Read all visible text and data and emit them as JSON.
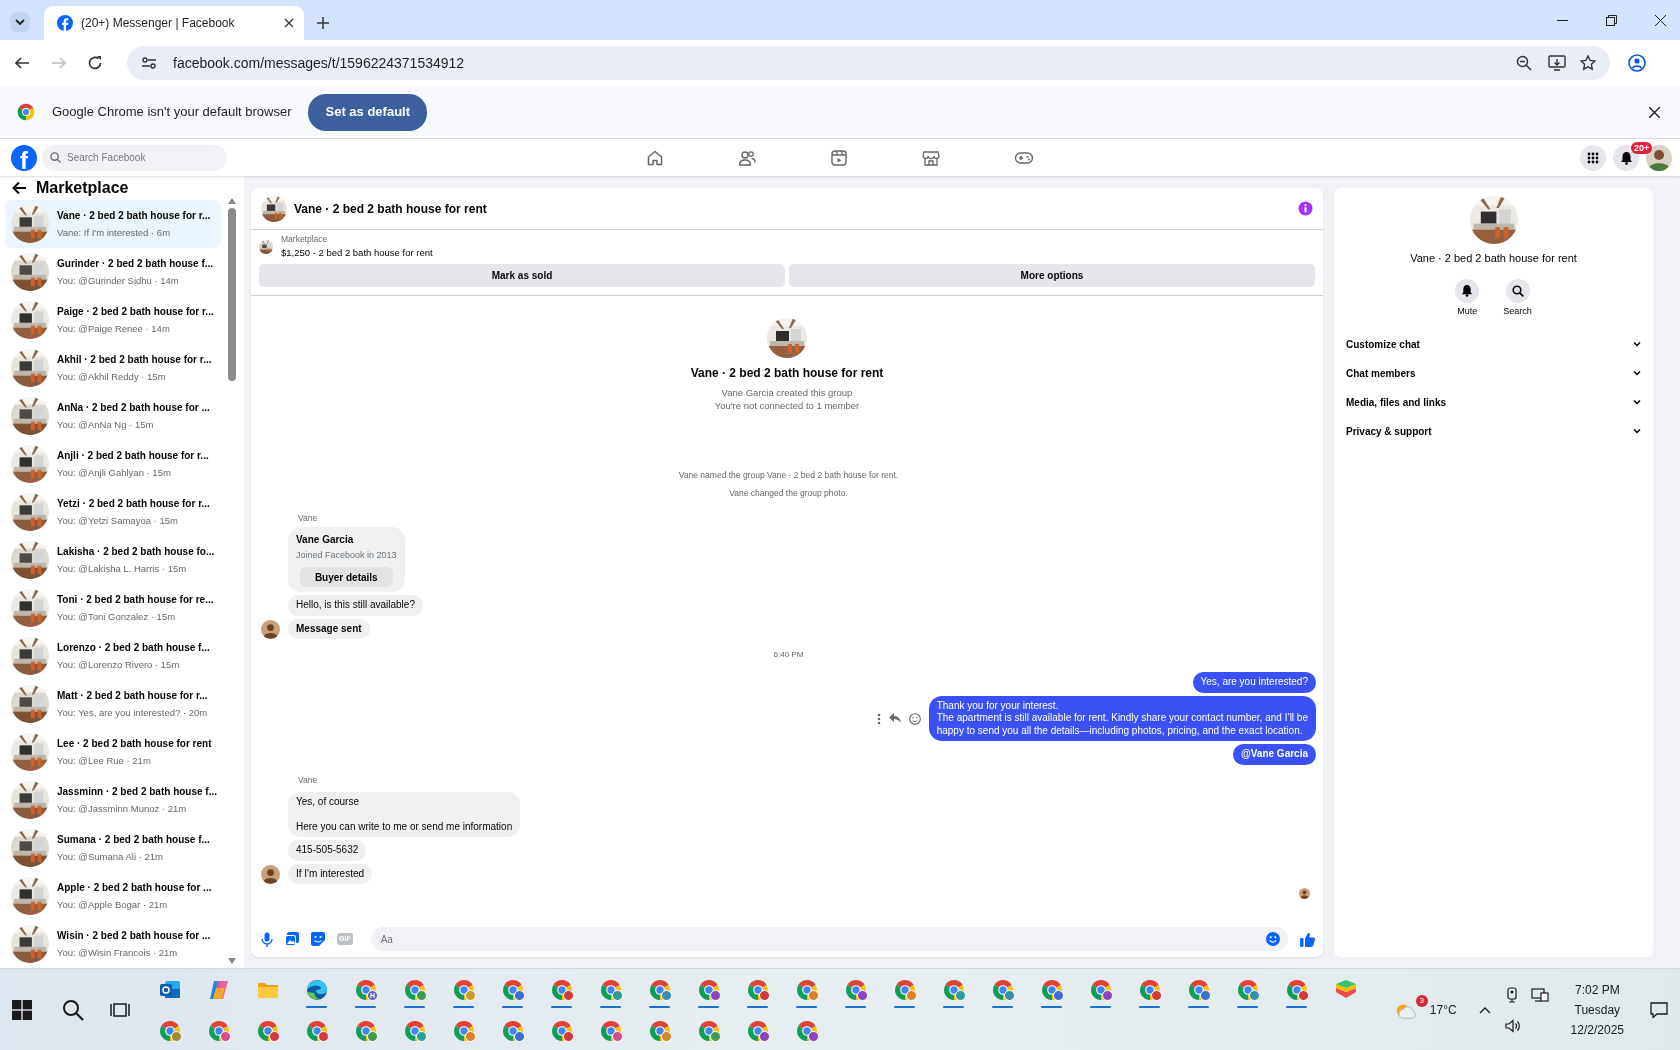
{
  "browser": {
    "tab_title": "(20+) Messenger | Facebook",
    "url": "facebook.com/messages/t/1596224371534912",
    "forward_disabled": true,
    "infobar": {
      "message": "Google Chrome isn't your default browser",
      "button": "Set as default"
    }
  },
  "facebook_nav": {
    "logo": "f",
    "search_placeholder": "Search Facebook",
    "notifications_badge": "20+"
  },
  "sidebar": {
    "title": "Marketplace",
    "conversations": [
      {
        "title": "Vane · 2 bed 2 bath house for r...",
        "preview": "Vane: If I'm interested · 6m",
        "selected": true
      },
      {
        "title": "Gurinder · 2 bed 2 bath house f...",
        "preview": "You: @Gurinder Sidhu · 14m",
        "selected": false
      },
      {
        "title": "Paige · 2 bed 2 bath house for r...",
        "preview": "You: @Paige Renee · 14m",
        "selected": false
      },
      {
        "title": "Akhil · 2 bed 2 bath house for r...",
        "preview": "You: @Akhil Reddy · 15m",
        "selected": false
      },
      {
        "title": "AnNa · 2 bed 2 bath house for ...",
        "preview": "You: @AnNa Ng · 15m",
        "selected": false
      },
      {
        "title": "Anjli · 2 bed 2 bath house for r...",
        "preview": "You: @Anjli Gahlyan · 15m",
        "selected": false
      },
      {
        "title": "Yetzi · 2 bed 2 bath house for r...",
        "preview": "You: @Yetzi Samayoa · 15m",
        "selected": false
      },
      {
        "title": "Lakisha · 2 bed 2 bath house fo...",
        "preview": "You: @Lakisha L. Harris · 15m",
        "selected": false
      },
      {
        "title": "Toni · 2 bed 2 bath house for re...",
        "preview": "You: @Toni Gonzalez · 15m",
        "selected": false
      },
      {
        "title": "Lorenzo · 2 bed 2 bath house f...",
        "preview": "You: @Lorenzo Rivero · 15m",
        "selected": false
      },
      {
        "title": "Matt · 2 bed 2 bath house for r...",
        "preview": "You: Yes, are you interested? · 20m",
        "selected": false
      },
      {
        "title": "Lee · 2 bed 2 bath house for rent",
        "preview": "You: @Lee Rue · 21m",
        "selected": false
      },
      {
        "title": "Jassminn · 2 bed 2 bath house f...",
        "preview": "You: @Jassminn Munoz · 21m",
        "selected": false
      },
      {
        "title": "Sumana · 2 bed 2 bath house f...",
        "preview": "You: @Sumana Ali · 21m",
        "selected": false
      },
      {
        "title": "Apple · 2 bed 2 bath house for ...",
        "preview": "You: @Apple Bogar · 21m",
        "selected": false
      },
      {
        "title": "Wisin · 2 bed 2 bath house for ...",
        "preview": "You: @Wisin Francois · 21m",
        "selected": false
      }
    ]
  },
  "chat": {
    "title": "Vane · 2 bed 2 bath house for rent",
    "listing": {
      "label": "Marketplace",
      "text": "$1,250 - 2 bed 2 bath house for rent"
    },
    "actions": [
      "Mark as sold",
      "More options"
    ],
    "intro": {
      "title": "Vane · 2 bed 2 bath house for rent",
      "lines": [
        "Vane Garcia created this group",
        "You're not connected to 1 member"
      ]
    },
    "messages": [
      {
        "kind": "system",
        "text": "Vane named the group Vane · 2 bed 2 bath house for rent."
      },
      {
        "kind": "system",
        "text": "Vane changed the group photo."
      },
      {
        "kind": "sender",
        "text": "Vane"
      },
      {
        "kind": "profile",
        "name": "Vane Garcia",
        "detail": "Joined Facebook in 2013",
        "button": "Buyer details"
      },
      {
        "kind": "incoming",
        "text": "Hello, is this still available?",
        "avatar": false,
        "bold": false
      },
      {
        "kind": "incoming",
        "text": "Message sent",
        "avatar": true,
        "bold": true
      },
      {
        "kind": "time",
        "text": "6:40 PM"
      },
      {
        "kind": "outgoing",
        "text": "Yes, are you interested?",
        "bold": false,
        "hovered": false
      },
      {
        "kind": "outgoing",
        "text": "Thank you for your interest.\nThe apartment is still available for rent. Kindly share your contact number, and I’ll be\nhappy to send you all the details—including photos, pricing, and the exact location.",
        "bold": false,
        "hovered": true
      },
      {
        "kind": "outgoing",
        "text": "@Vane Garcia",
        "bold": true,
        "hovered": false
      },
      {
        "kind": "sender",
        "text": "Vane"
      },
      {
        "kind": "incoming",
        "text": "Yes, of course\n\nHere you can write to me or send me information",
        "avatar": false,
        "bold": false
      },
      {
        "kind": "incoming",
        "text": "415-505-5632",
        "avatar": false,
        "bold": false
      },
      {
        "kind": "incoming",
        "text": "If I'm interested",
        "avatar": true,
        "bold": false
      },
      {
        "kind": "seen"
      }
    ],
    "composer": {
      "gif_label": "GIF",
      "placeholder": "Aa"
    }
  },
  "details": {
    "title": "Vane · 2 bed 2 bath house for rent",
    "buttons": [
      {
        "label": "Mute",
        "kind": "bell"
      },
      {
        "label": "Search",
        "kind": "search"
      }
    ],
    "sections": [
      {
        "label": "Customize chat",
        "expanded": false
      },
      {
        "label": "Chat members",
        "expanded": false
      },
      {
        "label": "Media, files and links",
        "expanded": false
      },
      {
        "label": "Privacy & support",
        "expanded": false
      }
    ]
  },
  "taskbar": {
    "apps": [
      {
        "kind": "outlook",
        "running": false
      },
      {
        "kind": "copilot",
        "running": false
      },
      {
        "kind": "explorer",
        "running": false
      },
      {
        "kind": "edge",
        "running": true
      },
      {
        "kind": "chrome",
        "running": true,
        "color": "#5b5fc7",
        "badge": "H"
      },
      {
        "kind": "chrome",
        "running": true,
        "color": "#3f9b4b"
      },
      {
        "kind": "chrome",
        "running": true,
        "color": "#c99a2e"
      },
      {
        "kind": "chrome",
        "running": true,
        "color": "#3b6fd6"
      },
      {
        "kind": "chrome",
        "running": true,
        "color": "#d13b3b"
      },
      {
        "kind": "chrome",
        "running": true,
        "color": "#2a9d9a"
      },
      {
        "kind": "chrome",
        "running": true,
        "color": "#3a8fb0"
      },
      {
        "kind": "chrome",
        "running": true,
        "color": "#8a46c2"
      },
      {
        "kind": "chrome",
        "running": true,
        "color": "#d13b3b"
      },
      {
        "kind": "chrome",
        "running": true,
        "color": "#d9822b"
      },
      {
        "kind": "chrome",
        "running": true,
        "color": "#8a46c2"
      },
      {
        "kind": "chrome",
        "running": true,
        "color": "#d9822b"
      },
      {
        "kind": "chrome",
        "running": true,
        "color": "#2a9d9a"
      },
      {
        "kind": "chrome",
        "running": true,
        "color": "#3a8fb0"
      },
      {
        "kind": "chrome",
        "running": true,
        "color": "#3b6fd6"
      },
      {
        "kind": "chrome",
        "running": true,
        "color": "#8a46c2"
      },
      {
        "kind": "chrome",
        "running": true,
        "color": "#d13b3b"
      },
      {
        "kind": "chrome",
        "running": true,
        "color": "#3b6fd6"
      },
      {
        "kind": "chrome",
        "running": true,
        "color": "#3a8fb0"
      },
      {
        "kind": "chrome",
        "running": true,
        "color": "#d13b3b"
      },
      {
        "kind": "bluestacks",
        "running": false
      }
    ],
    "overflow": [
      {
        "kind": "chrome",
        "color": "#9a8a3a"
      },
      {
        "kind": "chrome",
        "color": "#d94a8c"
      },
      {
        "kind": "chrome",
        "color": "#d13b3b"
      },
      {
        "kind": "chrome",
        "color": "#d13b3b"
      },
      {
        "kind": "chrome",
        "color": "#3f9b4b"
      },
      {
        "kind": "chrome",
        "color": "#2a9d9a"
      },
      {
        "kind": "chrome",
        "color": "#d9822b"
      },
      {
        "kind": "chrome",
        "color": "#3b6fd6"
      },
      {
        "kind": "chrome",
        "color": "#d13b3b"
      },
      {
        "kind": "chrome",
        "color": "#d94a8c"
      },
      {
        "kind": "chrome",
        "color": "#d9822b"
      },
      {
        "kind": "chrome",
        "color": "#3f9b4b"
      },
      {
        "kind": "chrome",
        "color": "#8a46c2"
      },
      {
        "kind": "chrome",
        "color": "#8a46c2"
      }
    ],
    "tray": {
      "weather_badge": "3",
      "temperature": "17°C",
      "time": "7:02 PM",
      "day": "Tuesday",
      "date": "12/2/2025"
    }
  }
}
